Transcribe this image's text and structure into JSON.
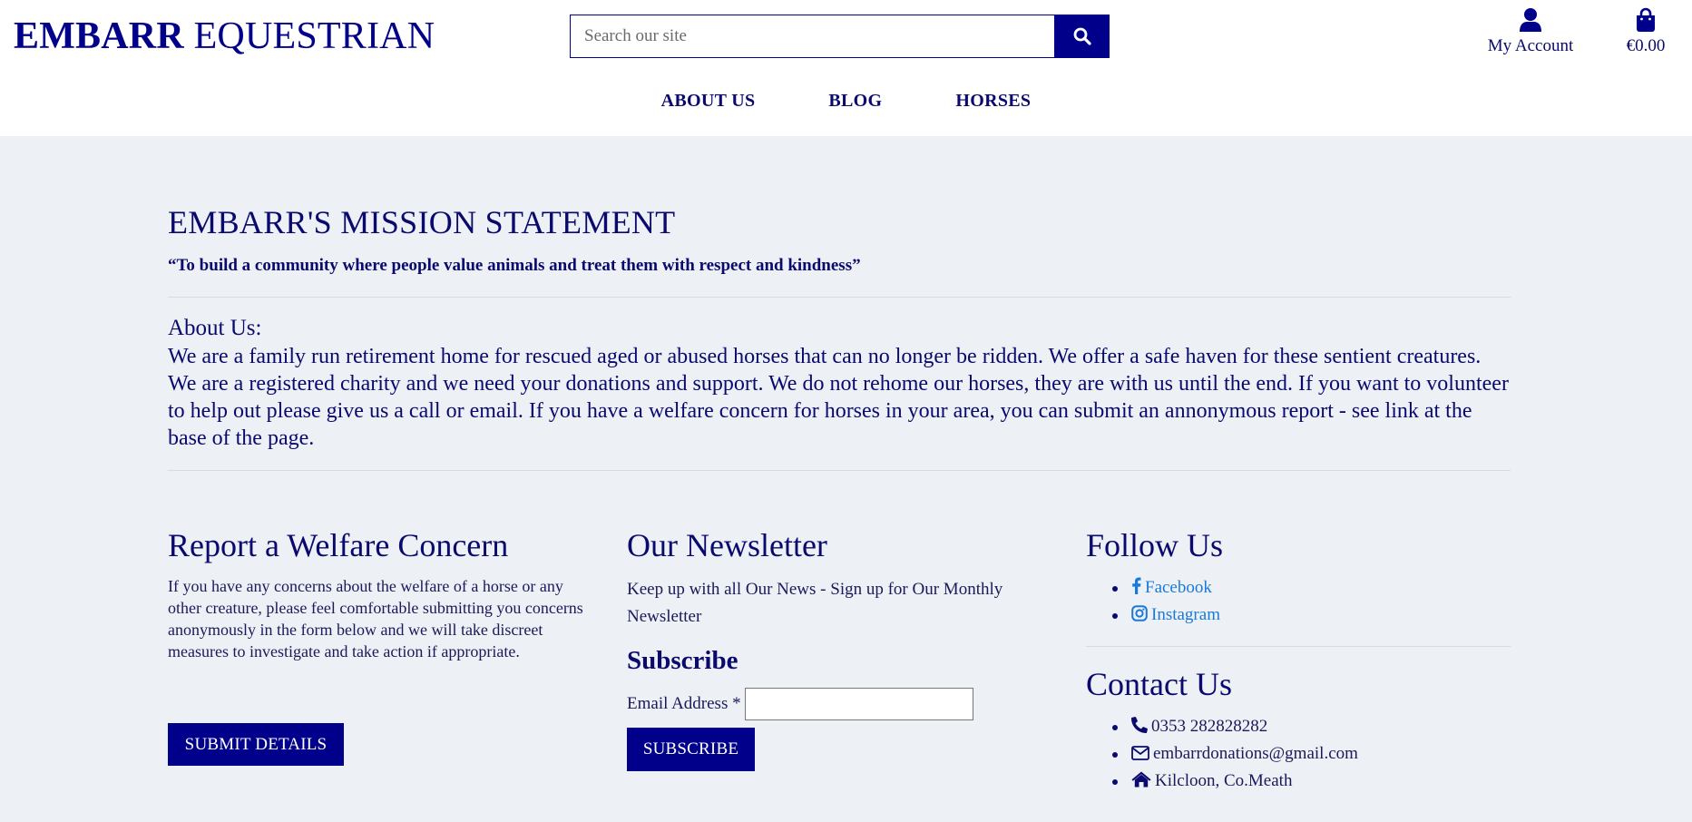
{
  "header": {
    "brand_bold": "EMBARR",
    "brand_light": "EQUESTRIAN",
    "search_placeholder": "Search our site",
    "search_icon": "search-icon",
    "account_label": "My Account",
    "account_icon": "user-icon",
    "bag_label": "€0.00",
    "bag_icon": "shopping-bag-icon"
  },
  "nav": {
    "items": [
      {
        "label": "ABOUT US"
      },
      {
        "label": "BLOG"
      },
      {
        "label": "HORSES"
      }
    ]
  },
  "mission": {
    "title": "EMBARR'S MISSION STATEMENT",
    "quote": "“To build a community where people value animals and treat them with respect and kindness”"
  },
  "about": {
    "heading": "About Us:",
    "body": "We are a family run retirement home for rescued aged or abused horses that can no longer be ridden. We offer a safe haven for these sentient creatures. We are a registered charity and we need your donations and support. We do not rehome our horses, they are with us until the end. If you want to volunteer to help out please give us a call or email. If you have a welfare concern for horses in your area, you can submit an annonymous report - see link at the base of the page."
  },
  "report": {
    "heading": "Report a Welfare Concern",
    "text": "If you have any concerns about the welfare of a horse or any other creature, please feel comfortable submitting you concerns anonymously in the form below and we will take discreet measures to investigate and take action if appropriate.",
    "button": "SUBMIT DETAILS"
  },
  "newsletter": {
    "heading": "Our Newsletter",
    "text": "Keep up with all Our News - Sign up for Our Monthly Newsletter",
    "subscribe_heading": "Subscribe",
    "email_label": "Email Address *",
    "email_value": "",
    "button": "SUBSCRIBE"
  },
  "follow": {
    "heading": "Follow Us",
    "items": [
      {
        "label": "Facebook",
        "icon": "facebook-icon"
      },
      {
        "label": "Instagram",
        "icon": "instagram-icon"
      }
    ]
  },
  "contact": {
    "heading": "Contact Us",
    "items": [
      {
        "label": "0353 282828282",
        "icon": "phone-icon"
      },
      {
        "label": "embarrdonations@gmail.com",
        "icon": "envelope-icon"
      },
      {
        "label": "Kilcloon, Co.Meath",
        "icon": "home-icon"
      }
    ]
  },
  "colors": {
    "primary": "#00008b",
    "text": "#0a0a6e",
    "background": "#edf0f5",
    "link": "#1a7ad9"
  }
}
